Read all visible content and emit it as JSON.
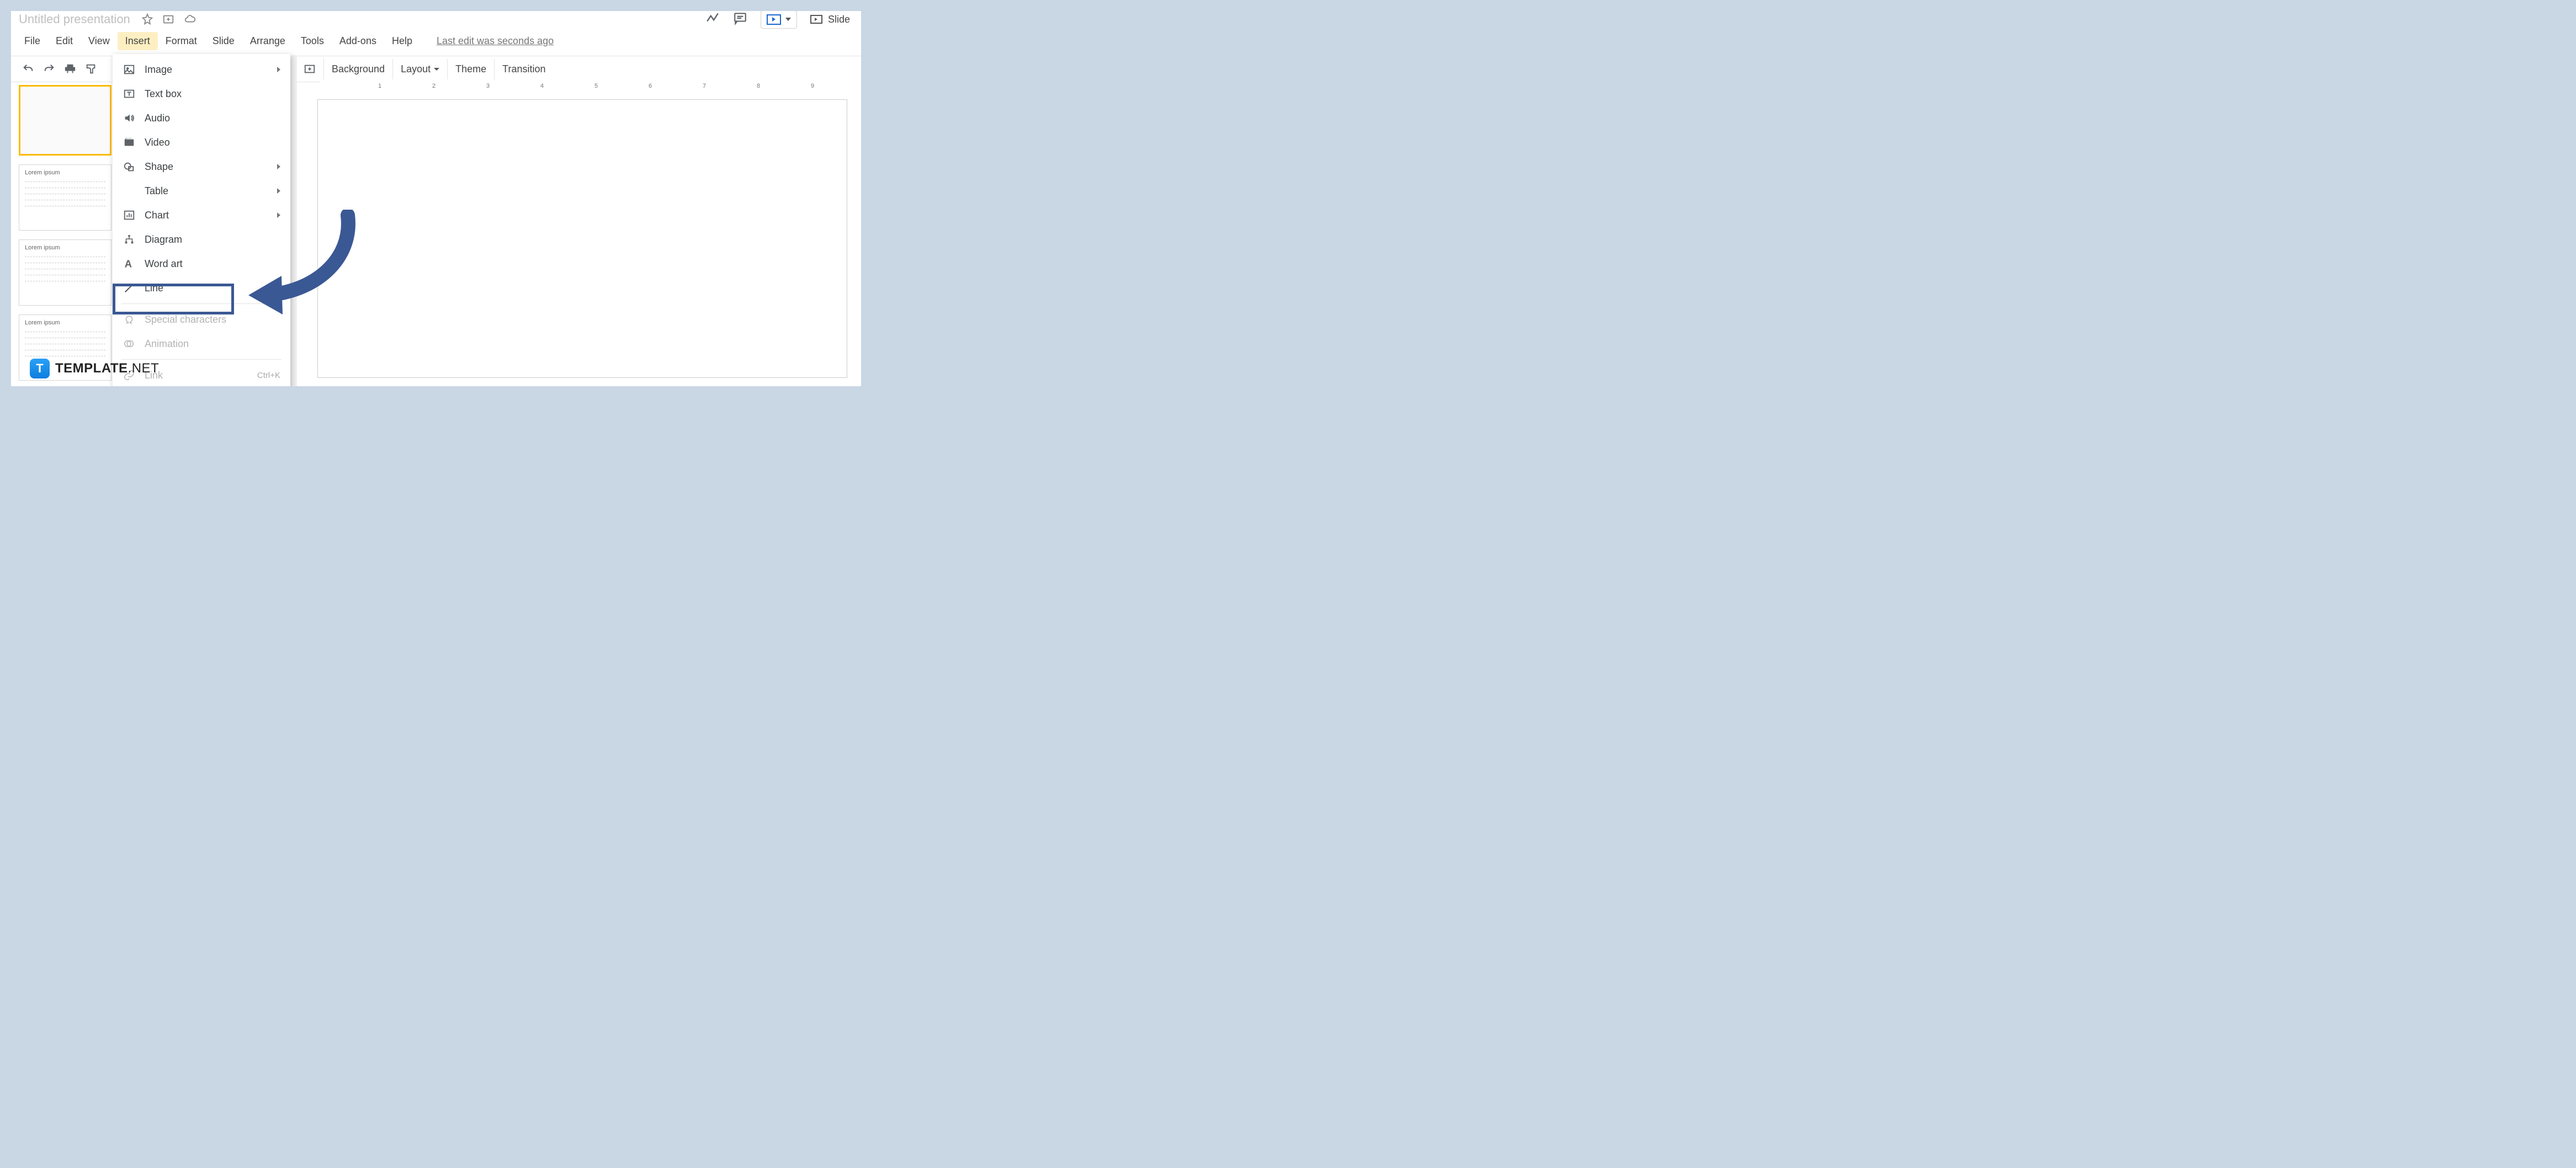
{
  "title": "Untitled presentation",
  "menus": {
    "file": "File",
    "edit": "Edit",
    "view": "View",
    "insert": "Insert",
    "format": "Format",
    "slide": "Slide",
    "arrange": "Arrange",
    "tools": "Tools",
    "addons": "Add-ons",
    "help": "Help"
  },
  "last_edit": "Last edit was seconds ago",
  "toolbar": {
    "background": "Background",
    "layout": "Layout",
    "theme": "Theme",
    "transition": "Transition"
  },
  "slideshow_label": "Slide",
  "insert_menu": {
    "image": "Image",
    "textbox": "Text box",
    "audio": "Audio",
    "video": "Video",
    "shape": "Shape",
    "table": "Table",
    "chart": "Chart",
    "diagram": "Diagram",
    "wordart": "Word art",
    "line": "Line",
    "special": "Special characters",
    "animation": "Animation",
    "link": "Link",
    "link_shortcut": "Ctrl+K"
  },
  "thumbs": {
    "lorem": "Lorem ipsum"
  },
  "ruler_numbers": [
    "1",
    "2",
    "3",
    "4",
    "5",
    "6",
    "7",
    "8",
    "9"
  ],
  "watermark": {
    "badge": "T",
    "text_bold": "TEMPLATE",
    "text_thin": ".NET"
  }
}
